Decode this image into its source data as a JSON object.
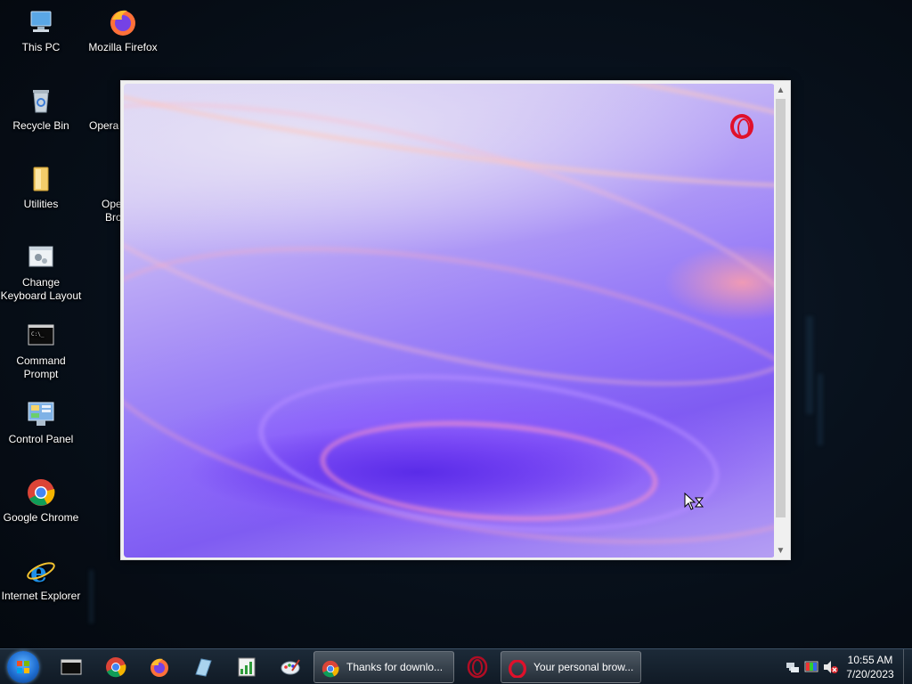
{
  "desktop": {
    "icons": [
      {
        "label": "This PC",
        "icon": "computer-icon"
      },
      {
        "label": "Mozilla Firefox",
        "icon": "firefox-icon"
      },
      {
        "label": "Recycle Bin",
        "icon": "recycle-bin-icon"
      },
      {
        "label": "Opera",
        "icon": "opera-icon"
      },
      {
        "label": "Utilities",
        "icon": "folder-icon"
      },
      {
        "label": "Ope",
        "sublabel": "Bro",
        "icon": "opera-browser-icon"
      },
      {
        "label": "Change",
        "sublabel": "Keyboard Layout",
        "icon": "keyboard-settings-icon"
      },
      {
        "label": "Command",
        "sublabel": "Prompt",
        "icon": "command-prompt-icon"
      },
      {
        "label": "Control Panel",
        "icon": "control-panel-icon"
      },
      {
        "label": "Google Chrome",
        "icon": "chrome-icon"
      },
      {
        "label": "Internet Explorer",
        "icon": "internet-explorer-icon"
      }
    ]
  },
  "installer": {
    "logo": "opera-logo-icon",
    "accent": "#e0102b",
    "scroll_up": "▲",
    "scroll_down": "▼"
  },
  "taskbar": {
    "pinned": [
      "command-prompt-icon",
      "chrome-icon",
      "firefox-icon",
      "notepad-icon",
      "spreadsheet-icon",
      "paint-icon"
    ],
    "tasks": [
      {
        "label": "Thanks for downlo...",
        "icon": "chrome-icon"
      },
      {
        "label": "",
        "icon": "opera-icon"
      },
      {
        "label": "Your personal brow...",
        "icon": "opera-icon"
      }
    ],
    "clock": {
      "time": "10:55 AM",
      "date": "7/20/2023"
    }
  }
}
